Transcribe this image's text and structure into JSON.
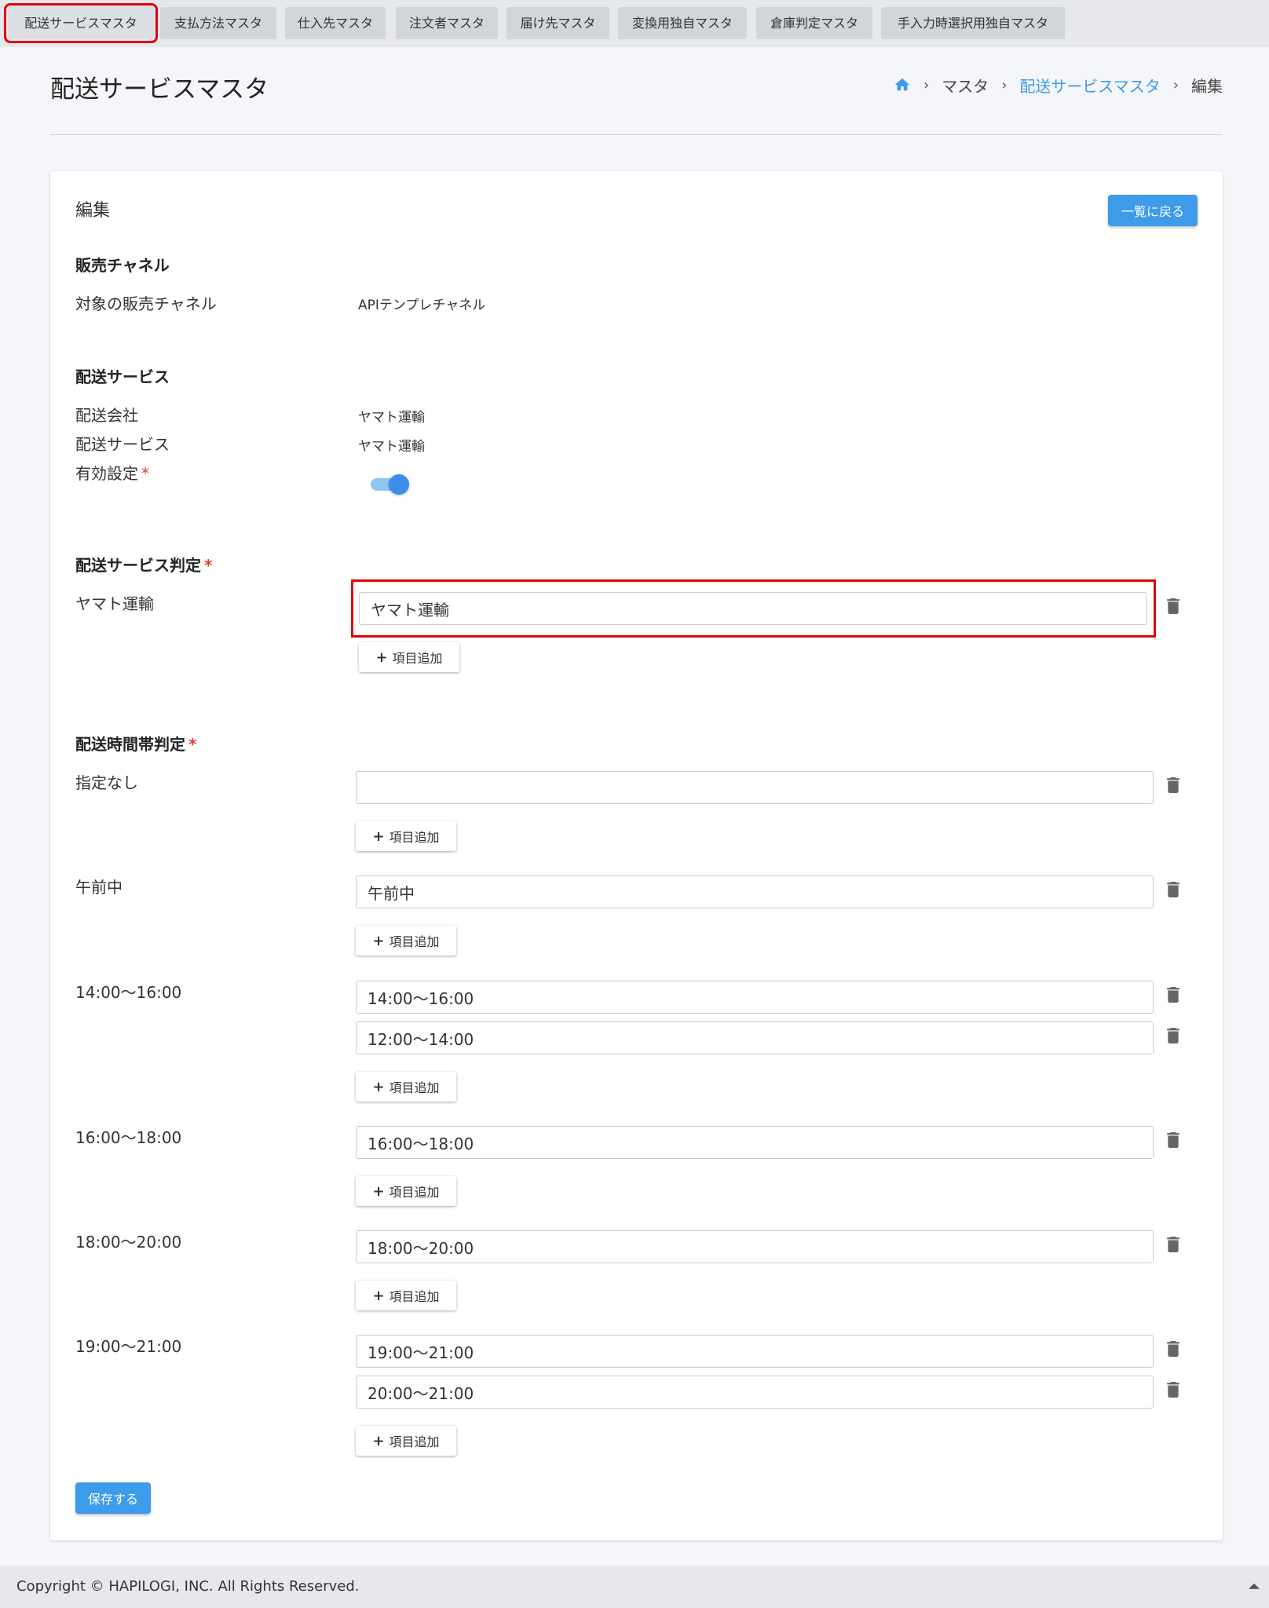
{
  "tabs": [
    {
      "label": "配送サービスマスタ"
    },
    {
      "label": "支払方法マスタ"
    },
    {
      "label": "仕入先マスタ"
    },
    {
      "label": "注文者マスタ"
    },
    {
      "label": "届け先マスタ"
    },
    {
      "label": "変換用独自マスタ"
    },
    {
      "label": "倉庫判定マスタ"
    },
    {
      "label": "手入力時選択用独自マスタ"
    }
  ],
  "header": {
    "title": "配送サービスマスタ",
    "breadcrumb": [
      "マスタ",
      "配送サービスマスタ",
      "編集"
    ]
  },
  "card": {
    "title": "編集",
    "back_label": "一覧に戻る",
    "sales_channel": {
      "heading": "販売チャネル",
      "label": "対象の販売チャネル",
      "value": "APIテンプレチャネル"
    },
    "delivery_service": {
      "heading": "配送サービス",
      "company_label": "配送会社",
      "company_value": "ヤマト運輸",
      "service_label": "配送サービス",
      "service_value": "ヤマト運輸",
      "enabled_label": "有効設定",
      "required_mark": "*"
    },
    "service_judgement": {
      "heading": "配送サービス判定",
      "required_mark": "*",
      "row_label": "ヤマト運輸",
      "input_value": "ヤマト運輸"
    },
    "time_judgement": {
      "heading": "配送時間帯判定",
      "required_mark": "*",
      "groups": [
        {
          "label": "指定なし",
          "inputs": [
            ""
          ]
        },
        {
          "label": "午前中",
          "inputs": [
            "午前中"
          ]
        },
        {
          "label": "14:00～16:00",
          "inputs": [
            "14:00～16:00",
            "12:00～14:00"
          ]
        },
        {
          "label": "16:00～18:00",
          "inputs": [
            "16:00～18:00"
          ]
        },
        {
          "label": "18:00～20:00",
          "inputs": [
            "18:00～20:00"
          ]
        },
        {
          "label": "19:00～21:00",
          "inputs": [
            "19:00～21:00",
            "20:00～21:00"
          ]
        }
      ]
    },
    "add_item_label": "項目追加",
    "save_label": "保存する"
  },
  "footer": {
    "copyright": "Copyright © HAPILOGI, INC. All Rights Reserved."
  },
  "colors": {
    "accent": "#3d9be9",
    "highlight": "#e30000",
    "required": "#e53935"
  }
}
